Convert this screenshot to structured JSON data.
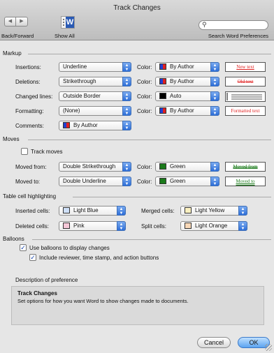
{
  "window": {
    "title": "Track Changes"
  },
  "toolbar": {
    "back_forward_label": "Back/Forward",
    "show_all_label": "Show All",
    "search_placeholder": "",
    "search_label": "Search Word Preferences"
  },
  "markup": {
    "header": "Markup",
    "color_label": "Color:",
    "rows": [
      {
        "label": "Insertions:",
        "value": "Underline",
        "color": "By Author",
        "preview": "New text"
      },
      {
        "label": "Deletions:",
        "value": "Strikethrough",
        "color": "By Author",
        "preview": "Old text"
      },
      {
        "label": "Changed lines:",
        "value": "Outside Border",
        "color": "Auto",
        "preview": ""
      },
      {
        "label": "Formatting:",
        "value": "(None)",
        "color": "By Author",
        "preview": "Formatted text"
      }
    ],
    "comments_label": "Comments:",
    "comments_value": "By Author"
  },
  "moves": {
    "header": "Moves",
    "track_moves_label": "Track moves",
    "track_moves_checked": false,
    "color_label": "Color:",
    "rows": [
      {
        "label": "Moved from:",
        "value": "Double Strikethrough",
        "color": "Green",
        "preview": "Moved from"
      },
      {
        "label": "Moved to:",
        "value": "Double Underline",
        "color": "Green",
        "preview": "Moved to"
      }
    ]
  },
  "table_cells": {
    "header": "Table cell highlighting",
    "inserted_label": "Inserted cells:",
    "inserted_value": "Light Blue",
    "deleted_label": "Deleted cells:",
    "deleted_value": "Pink",
    "merged_label": "Merged cells:",
    "merged_value": "Light Yellow",
    "split_label": "Split cells:",
    "split_value": "Light Orange"
  },
  "balloons": {
    "header": "Balloons",
    "use_balloons_label": "Use balloons to display changes",
    "use_balloons_checked": true,
    "include_reviewer_label": "Include reviewer, time stamp, and action buttons",
    "include_reviewer_checked": true
  },
  "description": {
    "header": "Description of preference",
    "title": "Track Changes",
    "text": "Set options for how you want Word to show changes made to documents."
  },
  "buttons": {
    "cancel": "Cancel",
    "ok": "OK"
  },
  "colors": {
    "author_blue": "#2040d0",
    "author_red": "#e02020",
    "green": "#1a7a1a",
    "accent": "#2e6fd8",
    "light_blue": "#cfe0f8",
    "pink": "#f6c8d8",
    "light_yellow": "#fbf0c0",
    "light_orange": "#f8d8b8"
  },
  "icons": [
    "back-arrow-icon",
    "forward-arrow-icon",
    "show-all-icon",
    "search-icon",
    "checkmark-icon",
    "popup-arrows-icon",
    "resize-grip-icon"
  ]
}
